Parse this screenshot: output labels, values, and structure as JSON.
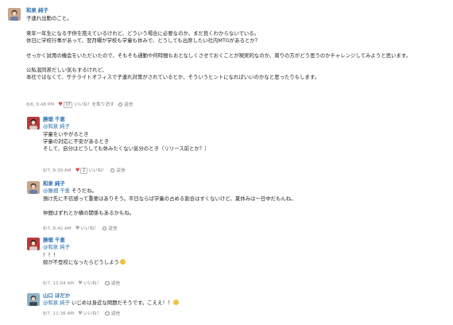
{
  "colors": {
    "link": "#2a6fb0",
    "heart": "#e04848",
    "meta": "#8a8a8a"
  },
  "main_post": {
    "author": "和泉 純子",
    "avatar_icon": "user-avatar",
    "lines": [
      "子連れ出勤のこと。",
      "",
      "来年一年生になる子供を抱えているけれど、どういう場合に必要なのか、まだ良くわからないでいる。",
      "休日に学校行事があって、翌月曜が学校も学童も休みで、どうしても出席したい社内MTGがあるとか？",
      "",
      "せっかく試用の機会をいただいたので、そもそも通勤や何時間もおとなしくさせておくことが現実的なのか、周りの方がどう思うのかチャレンジしてみようと思います。",
      "",
      "公私混同甚だしい気もするけれど、",
      "本社ではなくて、サテライトオフィスで子連れ対策がされているとか、そういうヒントになればいいのかなと思ったりもします。"
    ],
    "meta": {
      "timestamp": "8/6, 6:48 PM",
      "like_count": "17",
      "like_label": "いいね！を取り消す",
      "reply_label": "返信"
    }
  },
  "replies": [
    {
      "author": "勝畑 千恵",
      "mention": "@和泉 純子",
      "lines": [
        "学童をいやがるとき",
        "学童の対応に不安があるとき",
        "そして、自分はどうしても休みたくない気分のとき（リリース前とか？）"
      ],
      "meta": {
        "timestamp": "8/7, 8:39 AM",
        "like_count": "2",
        "like_label": "いいね！",
        "reply_label": "返信"
      }
    },
    {
      "author": "和泉 純子",
      "mention": "@勝畑 千恵",
      "mention_suffix": " そうだね。",
      "lines": [
        "預け先に不信感って重要はありそう。平日ならば学童の占める割合はすくないけど、夏休みは一日中だもんね。",
        "",
        "仲間はずれとか横の関係もあるかもね。"
      ],
      "meta": {
        "timestamp": "8/7, 8:42 AM",
        "like_label": "いいね！",
        "reply_label": "返信"
      }
    },
    {
      "author": "勝畑 千恵",
      "mention": "@和泉 純子",
      "lines": [
        "！！！",
        "娘が不登校になったらどうしよう"
      ],
      "meta": {
        "timestamp": "8/7, 11:04 AM",
        "like_label": "いいね！",
        "reply_label": "返信"
      }
    },
    {
      "author": "山口 ほだか",
      "mention": "@和泉 純子",
      "mention_suffix": " いじめは身近な問題だそうです。こええ！！",
      "lines": [],
      "meta": {
        "timestamp": "8/7, 11:36 AM",
        "like_label": "いいね！",
        "reply_label": "返信"
      }
    }
  ]
}
